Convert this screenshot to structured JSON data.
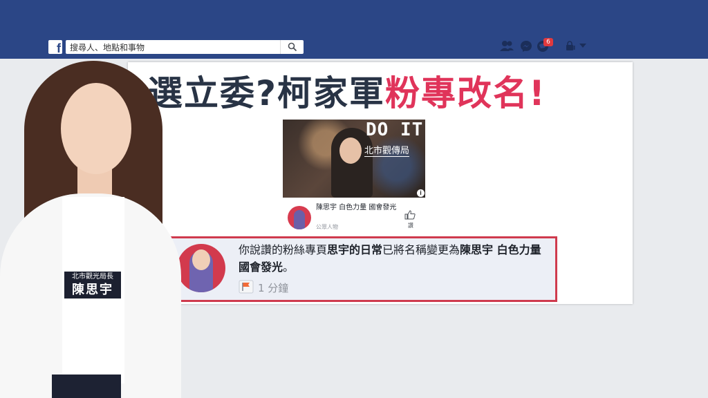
{
  "topbar": {
    "logo": "f",
    "search_placeholder": "搜尋人、地點和事物",
    "notification_count": "6",
    "icons": [
      "friends-icon",
      "messenger-icon",
      "globe-icon",
      "lock-icon",
      "caret-down-icon"
    ]
  },
  "headline": {
    "prefix": "選立委?柯家軍",
    "accent": "粉專改名!"
  },
  "video": {
    "overlay_title": "DO IT",
    "overlay_sub": "北市觀傳局",
    "info": "i"
  },
  "page_card": {
    "name": "陳思宇 白色力量 國會發光",
    "type": "公眾人物",
    "like_label": "讚"
  },
  "notification": {
    "part1": "你說讚的粉絲專頁",
    "bold1": "思宇的日常",
    "part2": "已將名稱變更為",
    "bold2": "陳思宇 白色力量 國會發光",
    "end": "。",
    "time": "1 分鐘"
  },
  "caption": {
    "role": "北市觀光局長",
    "name": "陳思宇"
  },
  "colors": {
    "topbar": "#2b4686",
    "accent": "#e0345a",
    "headline": "#283345",
    "highlight_border": "#cf3a4d"
  }
}
